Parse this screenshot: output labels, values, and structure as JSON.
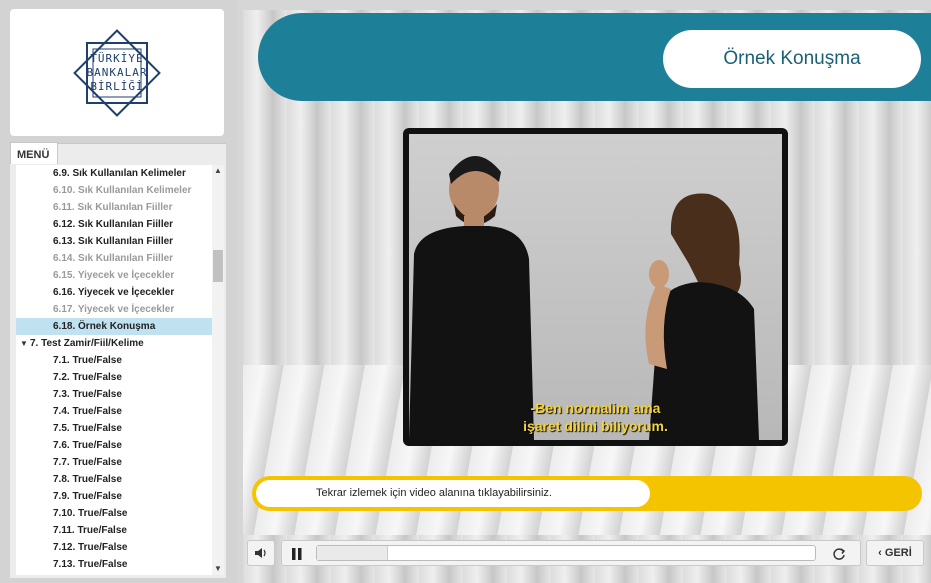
{
  "logo": {
    "lines": [
      "TÜRKİYE",
      "BANKALAR",
      "BİRLİĞİ"
    ],
    "color": "#1f3f6e"
  },
  "menu": {
    "tab_label": "MENÜ",
    "items": [
      {
        "label": "6.9. Sık Kullanılan Kelimeler",
        "level": 2,
        "state": "normal"
      },
      {
        "label": "6.10. Sık Kullanılan Kelimeler",
        "level": 2,
        "state": "dim"
      },
      {
        "label": "6.11. Sık Kullanılan Fiiller",
        "level": 2,
        "state": "dim"
      },
      {
        "label": "6.12. Sık Kullanılan Fiiller",
        "level": 2,
        "state": "normal"
      },
      {
        "label": "6.13. Sık Kullanılan Fiiller",
        "level": 2,
        "state": "normal"
      },
      {
        "label": "6.14. Sık Kullanılan Fiiller",
        "level": 2,
        "state": "dim"
      },
      {
        "label": "6.15. Yiyecek ve İçecekler",
        "level": 2,
        "state": "dim"
      },
      {
        "label": "6.16. Yiyecek ve İçecekler",
        "level": 2,
        "state": "normal"
      },
      {
        "label": "6.17. Yiyecek ve İçecekler",
        "level": 2,
        "state": "dim"
      },
      {
        "label": "6.18. Örnek Konuşma",
        "level": 2,
        "state": "selected"
      },
      {
        "label": "7. Test Zamir/Fiil/Kelime",
        "level": 1,
        "state": "normal"
      },
      {
        "label": "7.1. True/False",
        "level": 2,
        "state": "normal"
      },
      {
        "label": "7.2. True/False",
        "level": 2,
        "state": "normal"
      },
      {
        "label": "7.3. True/False",
        "level": 2,
        "state": "normal"
      },
      {
        "label": "7.4. True/False",
        "level": 2,
        "state": "normal"
      },
      {
        "label": "7.5. True/False",
        "level": 2,
        "state": "normal"
      },
      {
        "label": "7.6. True/False",
        "level": 2,
        "state": "normal"
      },
      {
        "label": "7.7. True/False",
        "level": 2,
        "state": "normal"
      },
      {
        "label": "7.8. True/False",
        "level": 2,
        "state": "normal"
      },
      {
        "label": "7.9. True/False",
        "level": 2,
        "state": "normal"
      },
      {
        "label": "7.10. True/False",
        "level": 2,
        "state": "normal"
      },
      {
        "label": "7.11. True/False",
        "level": 2,
        "state": "normal"
      },
      {
        "label": "7.12. True/False",
        "level": 2,
        "state": "normal"
      },
      {
        "label": "7.13. True/False",
        "level": 2,
        "state": "normal"
      }
    ],
    "scroll_position": 0.27
  },
  "header": {
    "title": "Örnek Konuşma",
    "bar_color": "#1e7f99"
  },
  "video": {
    "subtitle_line1": "-Ben normalim ama",
    "subtitle_line2": "işaret dilini biliyorum.",
    "subtitle_color": "#f3d23a"
  },
  "info": {
    "message": "Tekrar izlemek için video alanına tıklayabilirsiniz.",
    "bar_color": "#f5c400"
  },
  "controls": {
    "volume_icon": "volume-icon",
    "pause_icon": "pause-icon",
    "replay_icon": "replay-icon",
    "progress": 0.14,
    "back_label": "GERİ"
  }
}
